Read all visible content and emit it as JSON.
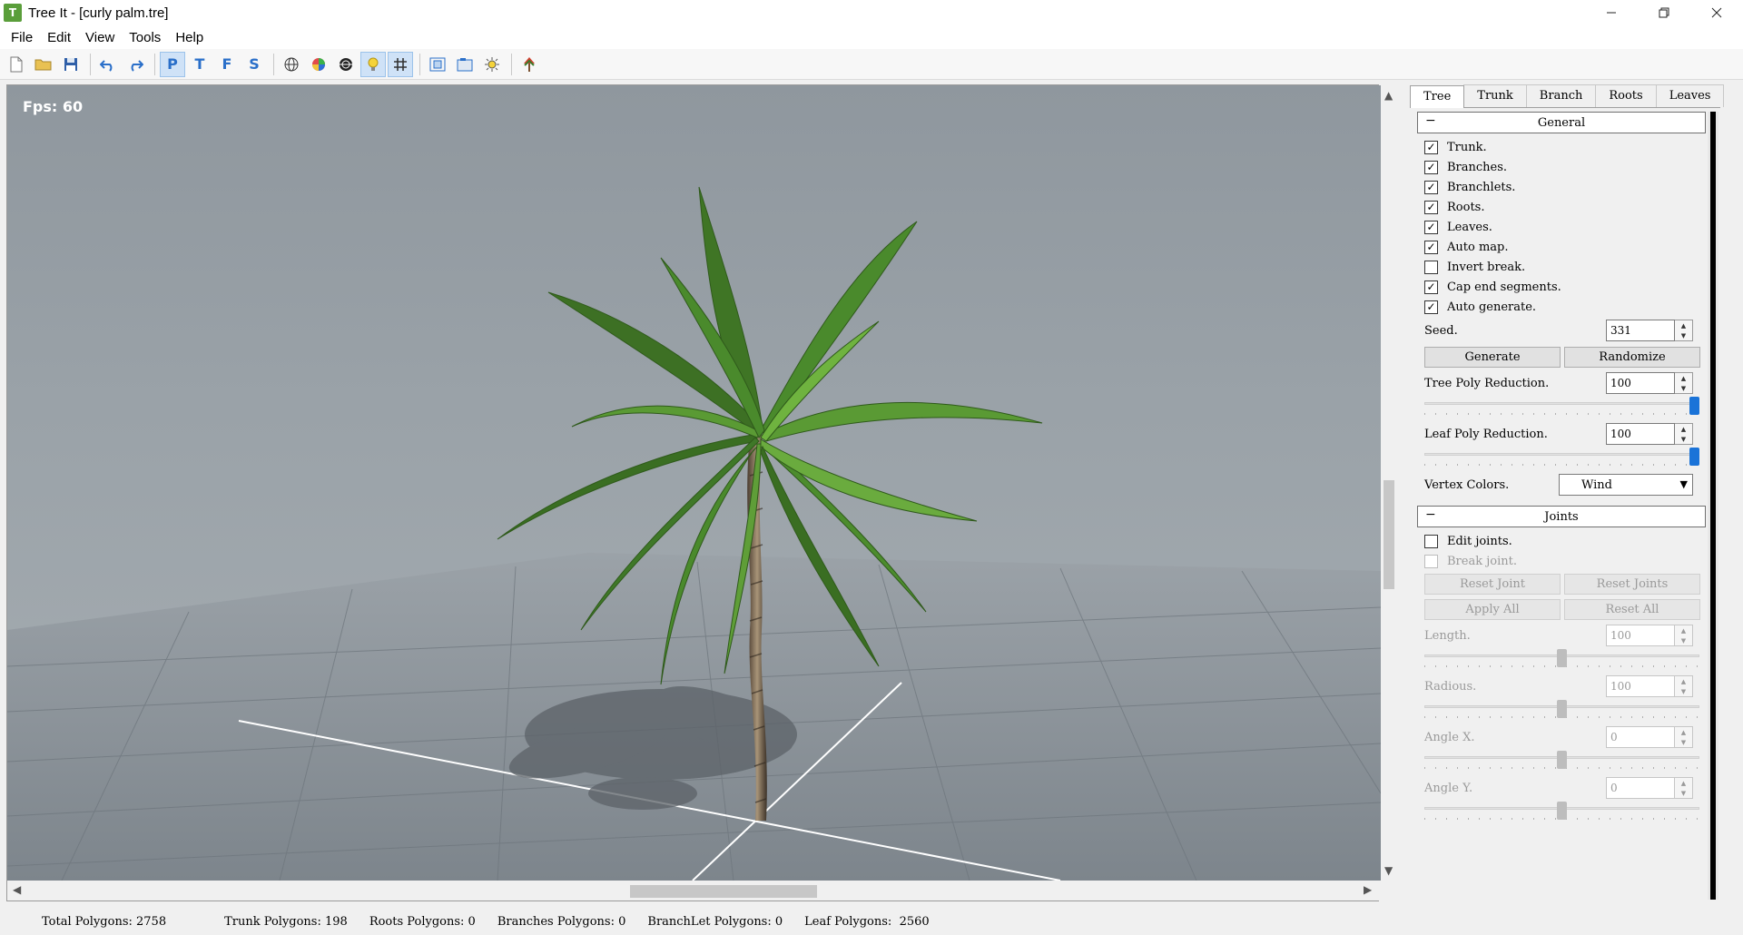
{
  "window": {
    "title": "Tree It - [curly palm.tre]",
    "app_icon_glyph": "T"
  },
  "menu": [
    "File",
    "Edit",
    "View",
    "Tools",
    "Help"
  ],
  "toolbar": {
    "letter_buttons": [
      "P",
      "T",
      "F",
      "S"
    ]
  },
  "viewport": {
    "fps": "Fps: 60"
  },
  "tabs": [
    "Tree",
    "Trunk",
    "Branch",
    "Roots",
    "Leaves"
  ],
  "general": {
    "header": "General",
    "collapse": "−",
    "checks": [
      {
        "label": "Trunk.",
        "checked": true
      },
      {
        "label": "Branches.",
        "checked": true
      },
      {
        "label": "Branchlets.",
        "checked": true
      },
      {
        "label": "Roots.",
        "checked": true
      },
      {
        "label": "Leaves.",
        "checked": true
      },
      {
        "label": "Auto map.",
        "checked": true
      },
      {
        "label": "Invert break.",
        "checked": false
      },
      {
        "label": "Cap end segments.",
        "checked": true
      },
      {
        "label": "Auto generate.",
        "checked": true
      }
    ],
    "seed_label": "Seed.",
    "seed_value": "331",
    "generate": "Generate",
    "randomize": "Randomize",
    "tree_poly_label": "Tree Poly Reduction.",
    "tree_poly_value": "100",
    "tree_poly_level": 1.0,
    "leaf_poly_label": "Leaf Poly Reduction.",
    "leaf_poly_value": "100",
    "leaf_poly_level": 1.0,
    "vertex_colors_label": "Vertex Colors.",
    "vertex_colors_value": "Wind"
  },
  "joints": {
    "header": "Joints",
    "collapse": "−",
    "edit_joints": {
      "label": "Edit joints.",
      "checked": false
    },
    "break_joint": {
      "label": "Break joint.",
      "checked": false
    },
    "reset_joint": "Reset Joint",
    "reset_joints": "Reset Joints",
    "apply_all": "Apply All",
    "reset_all": "Reset All",
    "length_label": "Length.",
    "length_value": "100",
    "radious_label": "Radious.",
    "radious_value": "100",
    "angle_x_label": "Angle X.",
    "angle_x_value": "0",
    "angle_y_label": "Angle Y.",
    "angle_y_value": "0",
    "slider_level": 0.5
  },
  "status": {
    "total": "Total Polygons: 2758",
    "trunk": "Trunk Polygons: 198",
    "roots": "Roots Polygons: 0",
    "branches": "Branches Polygons: 0",
    "branchlet": "BranchLet Polygons: 0",
    "leaf": "Leaf Polygons:  2560"
  },
  "colors": {
    "slider_accent": "#1a73d8",
    "viewport_bg": "#9aa2a8",
    "leaf_green": "#4f8a2e"
  }
}
